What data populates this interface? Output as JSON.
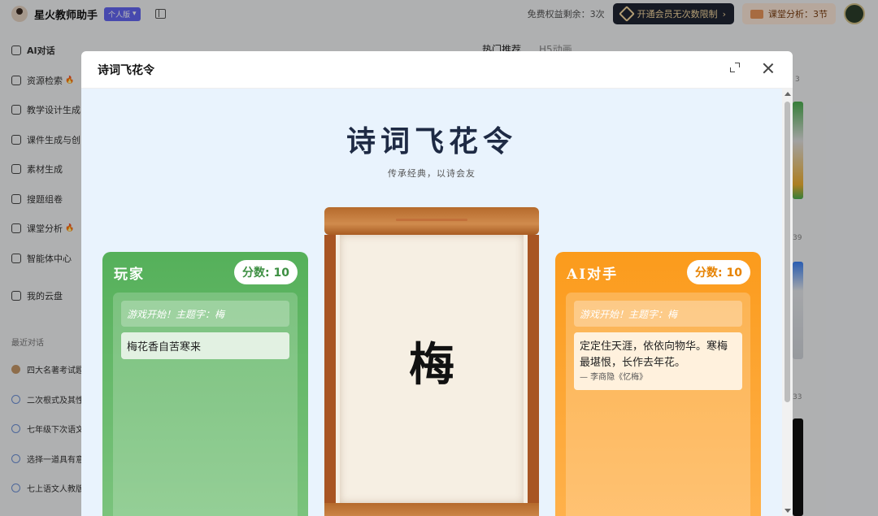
{
  "app": {
    "title": "星火教师助手",
    "edition": "个人版",
    "quota_text": "免费权益剩余：3次",
    "vip_button": "开通会员无次数限制",
    "class_analysis": "课堂分析：3节"
  },
  "sidebar": {
    "items": [
      {
        "label": "AI对话",
        "hot": false
      },
      {
        "label": "资源检索",
        "hot": true
      },
      {
        "label": "教学设计生成",
        "hot": false
      },
      {
        "label": "课件生成与创",
        "hot": false
      },
      {
        "label": "素材生成",
        "hot": false
      },
      {
        "label": "搜题组卷",
        "hot": false
      },
      {
        "label": "课堂分析",
        "hot": true
      },
      {
        "label": "智能体中心",
        "hot": false
      },
      {
        "label": "我的云盘",
        "hot": false
      }
    ],
    "recent_label": "最近对话",
    "recent": [
      "四大名著考试题",
      "二次根式及其性",
      "七年级下次语文",
      "选择一道具有意",
      "七上语文人教版"
    ]
  },
  "main": {
    "tab_hot": "热门推荐",
    "tab_h5": "H5动画",
    "right_numbers": [
      "3",
      "39",
      "33"
    ]
  },
  "modal": {
    "title": "诗词飞花令",
    "heading": "诗词飞花令",
    "subtitle": "传承经典，以诗会友",
    "center_char": "梅",
    "player": {
      "name": "玩家",
      "score": "分数: 10",
      "system_msg": "游戏开始！主题字：梅",
      "answer": "梅花香自苦寒来"
    },
    "ai": {
      "name": "AI对手",
      "score": "分数: 10",
      "system_msg": "游戏开始！主题字：梅",
      "answer": "定定住天涯，依依向物华。寒梅最堪恨，长作去年花。",
      "citation": "— 李商隐《忆梅》"
    }
  },
  "colors": {
    "player_green": "#55b05a",
    "ai_orange": "#fb9b1c",
    "modal_bg": "#e9f3fd",
    "scroll_wood": "#a85523"
  }
}
